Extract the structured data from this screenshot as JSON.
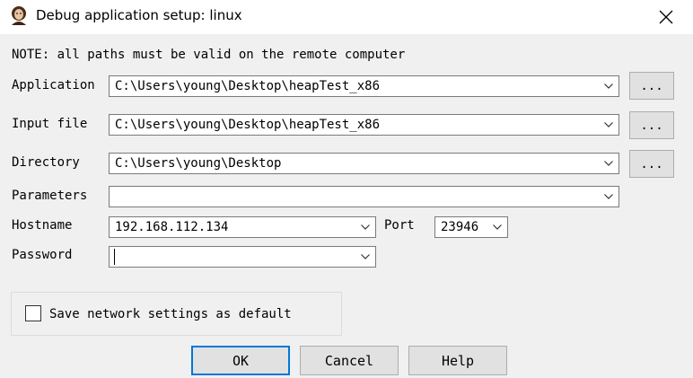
{
  "window": {
    "title": "Debug application setup: linux"
  },
  "note": "NOTE: all paths must be valid on the remote computer",
  "fields": {
    "application": {
      "label": "Application",
      "value": "C:\\Users\\young\\Desktop\\heapTest_x86"
    },
    "input_file": {
      "label": "Input file",
      "value": "C:\\Users\\young\\Desktop\\heapTest_x86"
    },
    "directory": {
      "label": "Directory",
      "value": "C:\\Users\\young\\Desktop"
    },
    "parameters": {
      "label": "Parameters",
      "value": ""
    },
    "hostname": {
      "label": "Hostname",
      "value": "192.168.112.134"
    },
    "port": {
      "label": "Port",
      "value": "23946"
    },
    "password": {
      "label": "Password",
      "value": ""
    }
  },
  "browse_label": "...",
  "save_default": {
    "label": "Save network settings as default",
    "checked": false
  },
  "buttons": {
    "ok": "OK",
    "cancel": "Cancel",
    "help": "Help"
  }
}
